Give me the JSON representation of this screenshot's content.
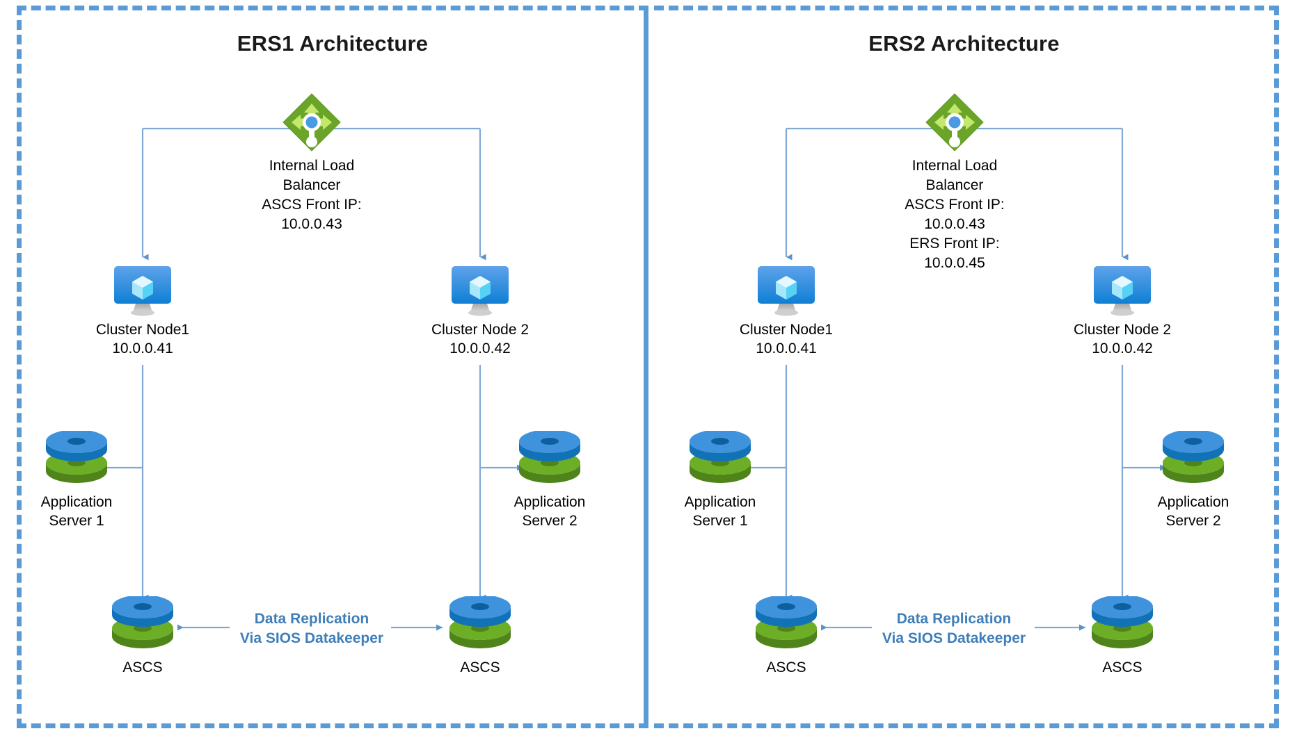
{
  "panels": [
    {
      "id": "ers1",
      "title": "ERS1 Architecture",
      "load_balancer": {
        "name": "Internal Load\nBalancer",
        "detail": "ASCS Front IP:\n10.0.0.43",
        "icon": "load-balancer-icon"
      },
      "cluster_nodes": [
        {
          "label": "Cluster Node1\n10.0.0.41",
          "icon": "monitor-icon"
        },
        {
          "label": "Cluster Node 2\n10.0.0.42",
          "icon": "monitor-icon"
        }
      ],
      "app_servers": [
        {
          "label": "Application\nServer 1",
          "icon": "disk-stack-icon"
        },
        {
          "label": "Application\nServer 2",
          "icon": "disk-stack-icon"
        }
      ],
      "ascs_nodes": [
        {
          "label": "ASCS",
          "icon": "disk-stack-icon"
        },
        {
          "label": "ASCS",
          "icon": "disk-stack-icon"
        }
      ],
      "replication": "Data Replication\nVia SIOS Datakeeper"
    },
    {
      "id": "ers2",
      "title": "ERS2 Architecture",
      "load_balancer": {
        "name": "Internal Load\nBalancer",
        "detail": "ASCS Front IP:\n10.0.0.43\nERS Front IP:\n10.0.0.45",
        "icon": "load-balancer-icon"
      },
      "cluster_nodes": [
        {
          "label": "Cluster Node1\n10.0.0.41",
          "icon": "monitor-icon"
        },
        {
          "label": "Cluster Node 2\n10.0.0.42",
          "icon": "monitor-icon"
        }
      ],
      "app_servers": [
        {
          "label": "Application\nServer 1",
          "icon": "disk-stack-icon"
        },
        {
          "label": "Application\nServer 2",
          "icon": "disk-stack-icon"
        }
      ],
      "ascs_nodes": [
        {
          "label": "ASCS",
          "icon": "disk-stack-icon"
        },
        {
          "label": "ASCS",
          "icon": "disk-stack-icon"
        }
      ],
      "replication": "Data Replication\nVia SIOS Datakeeper"
    }
  ],
  "colors": {
    "panel_border": "#5b9bd5",
    "connector": "#6d9fd0",
    "replication_text": "#3f7eb8",
    "lb_green_dark": "#5f9c20",
    "lb_green_light": "#b5e05a",
    "lb_center_blue": "#4b9ae4",
    "monitor_blue_top": "#5a9ce8",
    "monitor_blue_bottom": "#0f7fd4",
    "monitor_stand": "#c8c8c8",
    "disk_blue": "#2f8fd8",
    "disk_green": "#5f9e20",
    "title_text": "#1a1a1a"
  }
}
